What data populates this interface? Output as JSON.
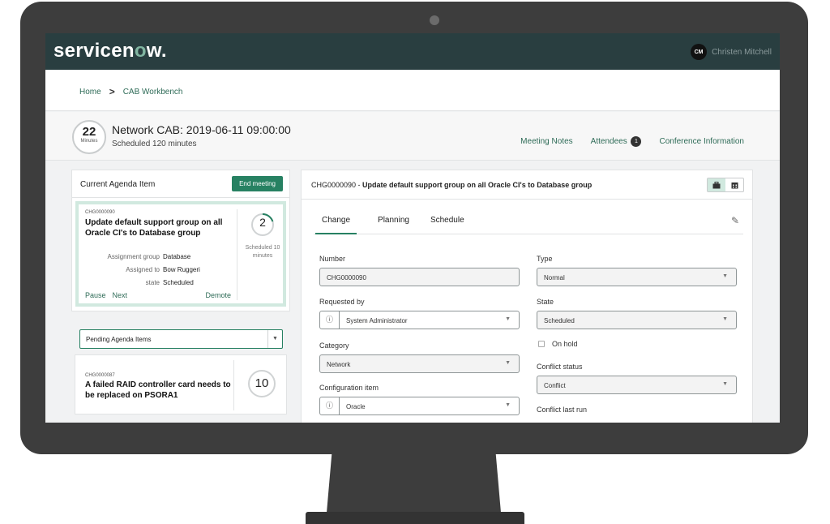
{
  "app": {
    "logo_left": "servicen",
    "logo_o": "o",
    "logo_right": "w."
  },
  "user": {
    "initials": "CM",
    "name": "Christen Mitchell"
  },
  "breadcrumb": {
    "home": "Home",
    "separator": ">",
    "current": "CAB Workbench"
  },
  "meeting": {
    "timer_value": "22",
    "timer_unit": "Minutes",
    "title": "Network CAB: 2019-06-11 09:00:00",
    "subtitle": "Scheduled 120 minutes",
    "links": {
      "notes": "Meeting Notes",
      "attendees": "Attendees",
      "attendee_count": "1",
      "conference": "Conference Information"
    }
  },
  "current_agenda": {
    "header": "Current Agenda Item",
    "end_button": "End meeting",
    "item": {
      "number": "CHG0000090",
      "title": "Update default support group on all Oracle CI's to Database group",
      "fields": [
        {
          "label": "Assignment group",
          "value": "Database"
        },
        {
          "label": "Assigned to",
          "value": "Bow Ruggeri"
        },
        {
          "label": "state",
          "value": "Scheduled"
        }
      ],
      "actions": {
        "pause": "Pause",
        "next": "Next",
        "demote": "Demote"
      },
      "timer_value": "2",
      "timer_progress": 0.2,
      "scheduled_text": "Scheduled 10 minutes"
    }
  },
  "pending": {
    "selected": "Pending Agenda Items",
    "item": {
      "number": "CHG0000087",
      "title": "A failed RAID controller card needs to be replaced on PSORA1",
      "timer_value": "10"
    }
  },
  "change": {
    "header_number": "CHG0000090",
    "header_sep": " - ",
    "header_title": "Update default support group on all Oracle CI's to Database group",
    "tabs": [
      "Change",
      "Planning",
      "Schedule"
    ],
    "fields": {
      "number": {
        "label": "Number",
        "value": "CHG0000090"
      },
      "requested_by": {
        "label": "Requested by",
        "value": "System Administrator"
      },
      "category": {
        "label": "Category",
        "value": "Network"
      },
      "configuration_item": {
        "label": "Configuration item",
        "value": "Oracle"
      },
      "type": {
        "label": "Type",
        "value": "Normal"
      },
      "state": {
        "label": "State",
        "value": "Scheduled"
      },
      "on_hold": {
        "label": "On hold",
        "checked": false
      },
      "conflict_status": {
        "label": "Conflict status",
        "value": "Conflict"
      },
      "conflict_last_run": {
        "label": "Conflict last run"
      }
    }
  },
  "colors": {
    "header_bg": "#293e40",
    "accent": "#278162",
    "logo_accent": "#81b5a1",
    "highlight": "#d1e9df",
    "link": "#2e6b57"
  },
  "icons": {
    "info": "info-icon",
    "caret": "chevron-down-icon",
    "pencil": "pencil-icon",
    "briefcase": "briefcase-icon",
    "calendar": "calendar-icon"
  }
}
